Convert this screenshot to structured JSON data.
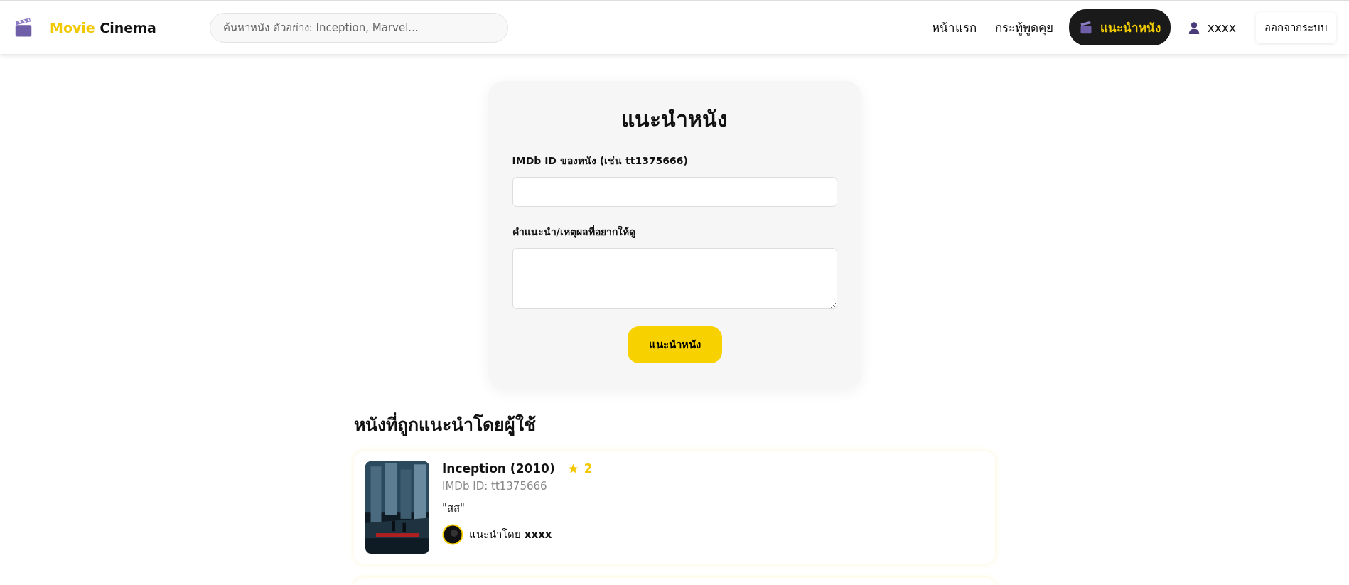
{
  "brand": {
    "first": "Movie",
    "second": "Cinema"
  },
  "search": {
    "placeholder": "ค้นหาหนัง ตัวอย่าง: Inception, Marvel..."
  },
  "nav": [
    {
      "label": "หน้าแรก",
      "selected": false,
      "kind": "link"
    },
    {
      "label": "กระทู้พูดคุย",
      "selected": false,
      "kind": "link"
    },
    {
      "label": "แนะนำหนัง",
      "selected": true,
      "kind": "clapper"
    }
  ],
  "user": {
    "name": "xxxx"
  },
  "logout": "ออกจากระบบ",
  "form": {
    "title": "แนะนำหนัง",
    "id_label": "IMDb ID ของหนัง (เช่น tt1375666)",
    "reason_label": "คำแนะนำ/เหตุผลที่อยากให้ดู",
    "submit": "แนะนำหนัง"
  },
  "list_title": "หนังที่ถูกแนะนำโดยผู้ใช้",
  "recommendations": [
    {
      "title": "Inception (2010)",
      "score": "2",
      "imdb": "IMDb ID: tt1375666",
      "comment": "\"สส\"",
      "by_label": "แนะนำโดย",
      "by_user": "xxxx"
    }
  ]
}
